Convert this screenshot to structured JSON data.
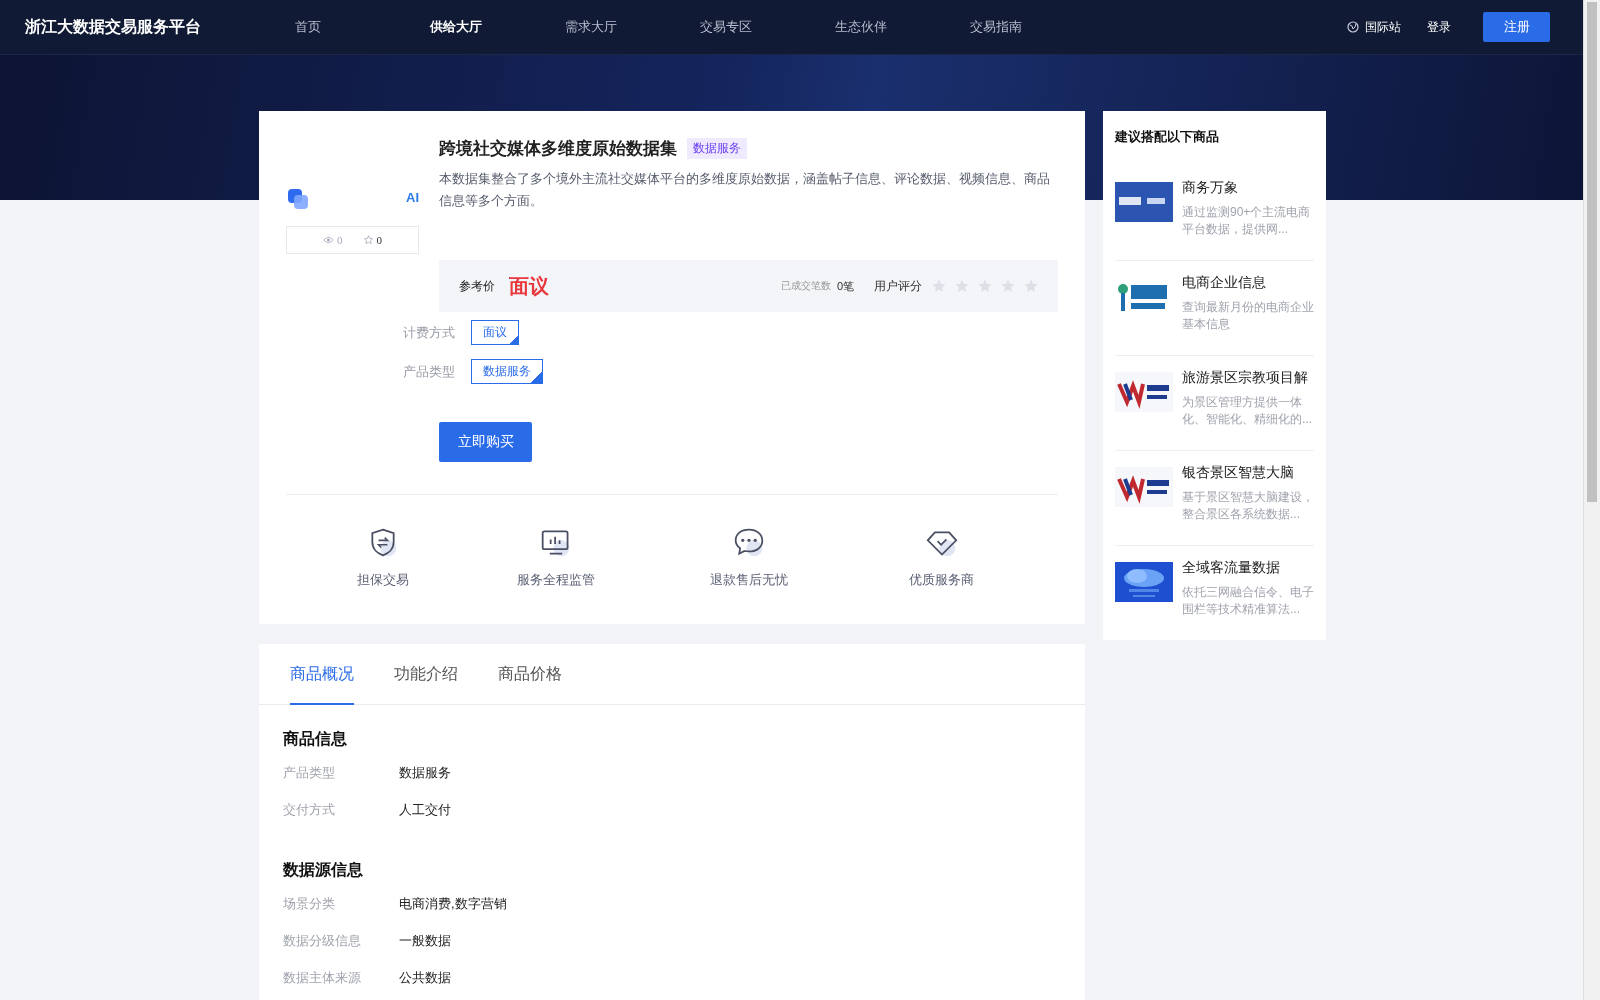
{
  "nav": {
    "logo": "浙江大数据交易服务平台",
    "items": [
      {
        "label": "首页",
        "selected": false
      },
      {
        "label": "供给大厅",
        "selected": true
      },
      {
        "label": "需求大厅",
        "selected": false
      },
      {
        "label": "交易专区",
        "selected": false
      },
      {
        "label": "生态伙伴",
        "selected": false
      },
      {
        "label": "交易指南",
        "selected": false
      }
    ],
    "intl": "国际站",
    "login": "登录",
    "register": "注册"
  },
  "product": {
    "ai_badge": "AI",
    "views": "0",
    "favorites": "0",
    "title": "跨境社交媒体多维度原始数据集",
    "tag": "数据服务",
    "description": "本数据集整合了多个境外主流社交媒体平台的多维度原始数据，涵盖帖子信息、评论数据、视频信息、商品信息等多个方面。",
    "price_label": "参考价",
    "price": "面议",
    "deals_label": "已成交笔数",
    "deals": "0笔",
    "rating_label": "用户评分",
    "stars": 0,
    "specs": [
      {
        "label": "计费方式",
        "value": "面议"
      },
      {
        "label": "产品类型",
        "value": "数据服务"
      }
    ],
    "buy_button": "立即购买",
    "guarantees": [
      {
        "kind": "shield",
        "label": "担保交易"
      },
      {
        "kind": "monitor",
        "label": "服务全程监管"
      },
      {
        "kind": "chat",
        "label": "退款售后无忧"
      },
      {
        "kind": "diamond",
        "label": "优质服务商"
      }
    ]
  },
  "tabs": [
    {
      "label": "商品概况",
      "selected": true
    },
    {
      "label": "功能介绍",
      "selected": false
    },
    {
      "label": "商品价格",
      "selected": false
    }
  ],
  "sections": [
    {
      "title": "商品信息",
      "rows": [
        {
          "label": "产品类型",
          "value": "数据服务"
        },
        {
          "label": "交付方式",
          "value": "人工交付"
        }
      ]
    },
    {
      "title": "数据源信息",
      "rows": [
        {
          "label": "场景分类",
          "value": "电商消费,数字营销"
        },
        {
          "label": "数据分级信息",
          "value": "一般数据"
        },
        {
          "label": "数据主体来源",
          "value": "公共数据"
        }
      ]
    }
  ],
  "suggestions": {
    "title": "建议搭配以下商品",
    "items": [
      {
        "kind": "picture",
        "name": "商务万象",
        "description": "通过监测90+个主流电商平台数据，提供网..."
      },
      {
        "kind": "picture",
        "name": "电商企业信息",
        "description": "查询最新月份的电商企业基本信息"
      },
      {
        "kind": "picture",
        "name": "旅游景区宗教项目解",
        "description": "为景区管理方提供一体化、智能化、精细化的..."
      },
      {
        "kind": "picture",
        "name": "银杏景区智慧大脑",
        "description": "基于景区智慧大脑建设，整合景区各系统数据..."
      },
      {
        "kind": "picture",
        "name": "全域客流量数据",
        "description": "依托三网融合信令、电子围栏等技术精准算法..."
      }
    ]
  }
}
